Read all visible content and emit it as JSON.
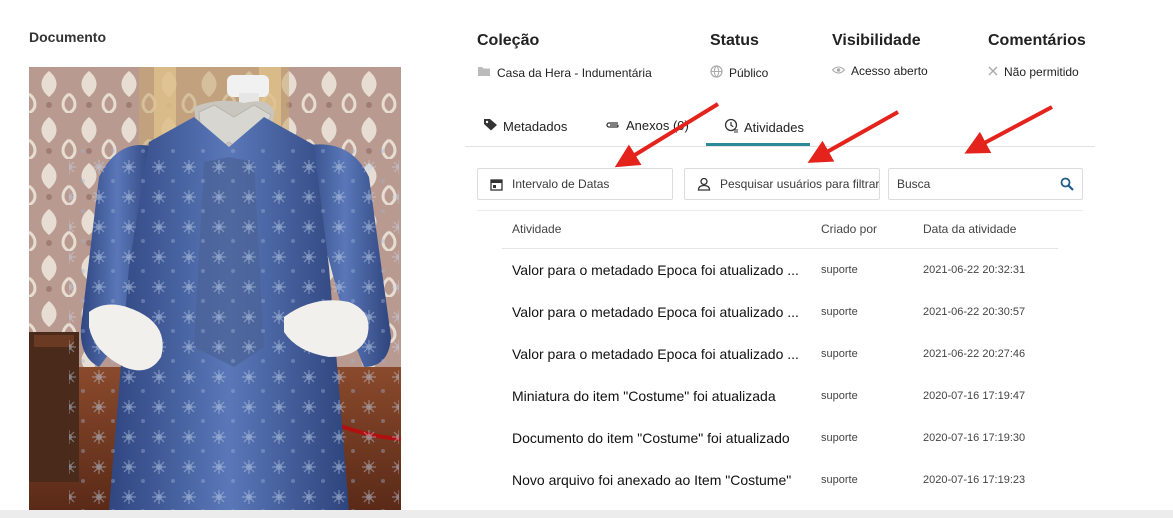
{
  "document": {
    "title": "Documento"
  },
  "meta": {
    "collection": {
      "label": "Coleção",
      "value": "Casa da Hera - Indumentária",
      "icon": "folder-icon"
    },
    "status": {
      "label": "Status",
      "value": "Público",
      "icon": "globe-icon"
    },
    "visibility": {
      "label": "Visibilidade",
      "value": "Acesso aberto",
      "icon": "eye-icon"
    },
    "comments": {
      "label": "Comentários",
      "value": "Não permitido",
      "icon": "close-icon"
    }
  },
  "tabs": [
    {
      "label": "Metadados",
      "icon": "tag-icon"
    },
    {
      "label": "Anexos (0)",
      "icon": "paperclip-icon"
    },
    {
      "label": "Atividades",
      "icon": "history-icon",
      "active": true
    }
  ],
  "filters": {
    "date_range": "Intervalo de Datas",
    "user_search_placeholder": "Pesquisar usuários para filtrar",
    "search_placeholder": "Busca"
  },
  "table": {
    "headers": {
      "activity": "Atividade",
      "created_by": "Criado por",
      "date": "Data da atividade"
    },
    "rows": [
      {
        "activity": "Valor para o metadado Epoca foi atualizado ...",
        "created_by": "suporte",
        "date": "2021-06-22 20:32:31"
      },
      {
        "activity": "Valor para o metadado Epoca foi atualizado ...",
        "created_by": "suporte",
        "date": "2021-06-22 20:30:57"
      },
      {
        "activity": "Valor para o metadado Epoca foi atualizado ...",
        "created_by": "suporte",
        "date": "2021-06-22 20:27:46"
      },
      {
        "activity": "Miniatura do item \"Costume\" foi atualizada",
        "created_by": "suporte",
        "date": "2020-07-16 17:19:47"
      },
      {
        "activity": "Documento do item \"Costume\" foi atualizado",
        "created_by": "suporte",
        "date": "2020-07-16 17:19:30"
      },
      {
        "activity": "Novo arquivo foi anexado ao Item \"Costume\"",
        "created_by": "suporte",
        "date": "2020-07-16 17:19:23"
      }
    ]
  },
  "colors": {
    "accent": "#2a8a97",
    "arrow": "#e3231c",
    "dress": "#3e5a9c"
  }
}
